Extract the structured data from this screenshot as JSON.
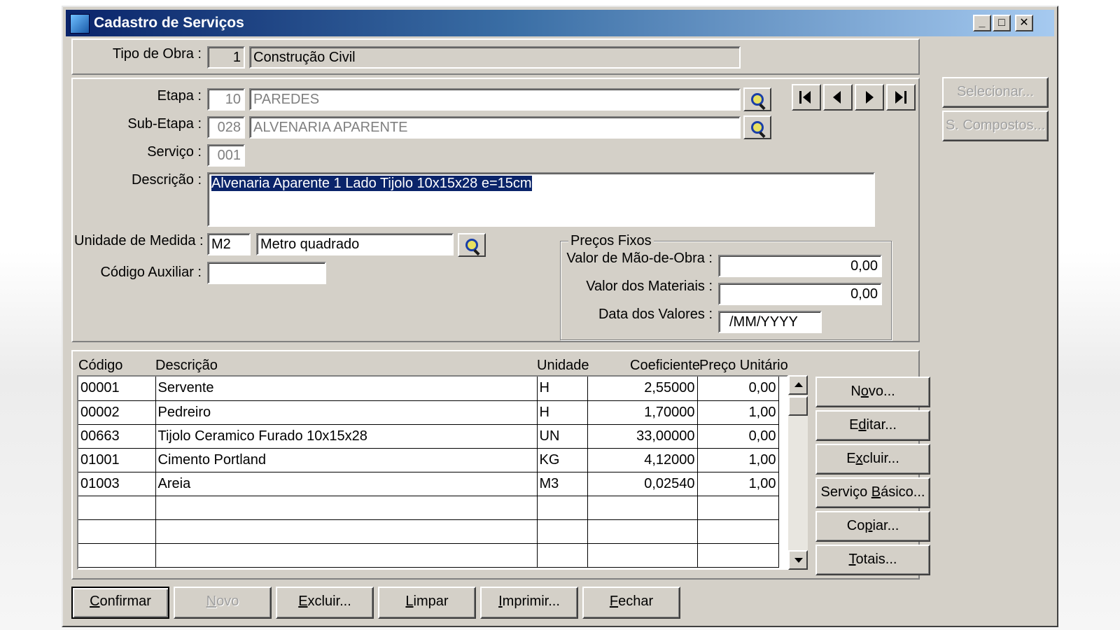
{
  "window": {
    "title": "Cadastro de Serviços",
    "controls": {
      "minimize": "_",
      "maximize": "□",
      "close": "✕"
    }
  },
  "obra": {
    "tipo_label": "Tipo de Obra :",
    "tipo_codigo": "1",
    "tipo_nome": "Construção Civil"
  },
  "form": {
    "etapa_label": "Etapa :",
    "etapa_codigo": "10",
    "etapa_nome": "PAREDES",
    "subetapa_label": "Sub-Etapa :",
    "subetapa_codigo": "028",
    "subetapa_nome": "ALVENARIA APARENTE",
    "servico_label": "Serviço :",
    "servico_codigo": "001",
    "descricao_label": "Descrição :",
    "descricao_value": "Alvenaria Aparente 1 Lado Tijolo 10x15x28 e=15cm",
    "unidade_label": "Unidade de Medida :",
    "unidade_codigo": "M2",
    "unidade_nome": "Metro quadrado",
    "codigo_aux_label": "Código Auxiliar :",
    "codigo_aux_value": ""
  },
  "precos": {
    "group_label": "Preços Fixos",
    "mao_obra_label": "Valor de Mão-de-Obra :",
    "mao_obra_value": "0,00",
    "materiais_label": "Valor dos Materiais :",
    "materiais_value": "0,00",
    "data_label": "Data dos Valores :",
    "data_value": "/MM/YYYY"
  },
  "side_buttons": {
    "selecionar": "Selecionar...",
    "compostos": "S. Compostos..."
  },
  "table": {
    "headers": [
      "Código",
      "Descrição",
      "Unidade",
      "Coeficiente",
      "Preço Unitário"
    ],
    "rows": [
      [
        "00001",
        "Servente",
        "H",
        "2,55000",
        "0,00"
      ],
      [
        "00002",
        "Pedreiro",
        "H",
        "1,70000",
        "1,00"
      ],
      [
        "00663",
        "Tijolo Ceramico Furado 10x15x28",
        "UN",
        "33,00000",
        "0,00"
      ],
      [
        "01001",
        "Cimento Portland",
        "KG",
        "4,12000",
        "1,00"
      ],
      [
        "01003",
        "Areia",
        "M3",
        "0,02540",
        "1,00"
      ],
      [
        "",
        "",
        "",
        "",
        ""
      ],
      [
        "",
        "",
        "",
        "",
        ""
      ],
      [
        "",
        "",
        "",
        "",
        ""
      ]
    ]
  },
  "grid_buttons": {
    "novo": [
      "N",
      "o",
      "vo..."
    ],
    "editar": [
      "E",
      "d",
      "itar..."
    ],
    "excluir": [
      "E",
      "x",
      "cluir..."
    ],
    "servico_basico": [
      "Serviço ",
      "B",
      "ásico..."
    ],
    "copiar": [
      "Co",
      "p",
      "iar..."
    ],
    "totais": [
      "",
      "T",
      "otais..."
    ]
  },
  "footer_buttons": {
    "confirmar": [
      "",
      "C",
      "onfirmar"
    ],
    "novo": [
      "",
      "N",
      "ovo"
    ],
    "excluir": [
      "",
      "E",
      "xcluir..."
    ],
    "limpar": [
      "",
      "L",
      "impar"
    ],
    "imprimir": [
      "",
      "I",
      "mprimir..."
    ],
    "fechar": [
      "",
      "F",
      "echar"
    ]
  }
}
